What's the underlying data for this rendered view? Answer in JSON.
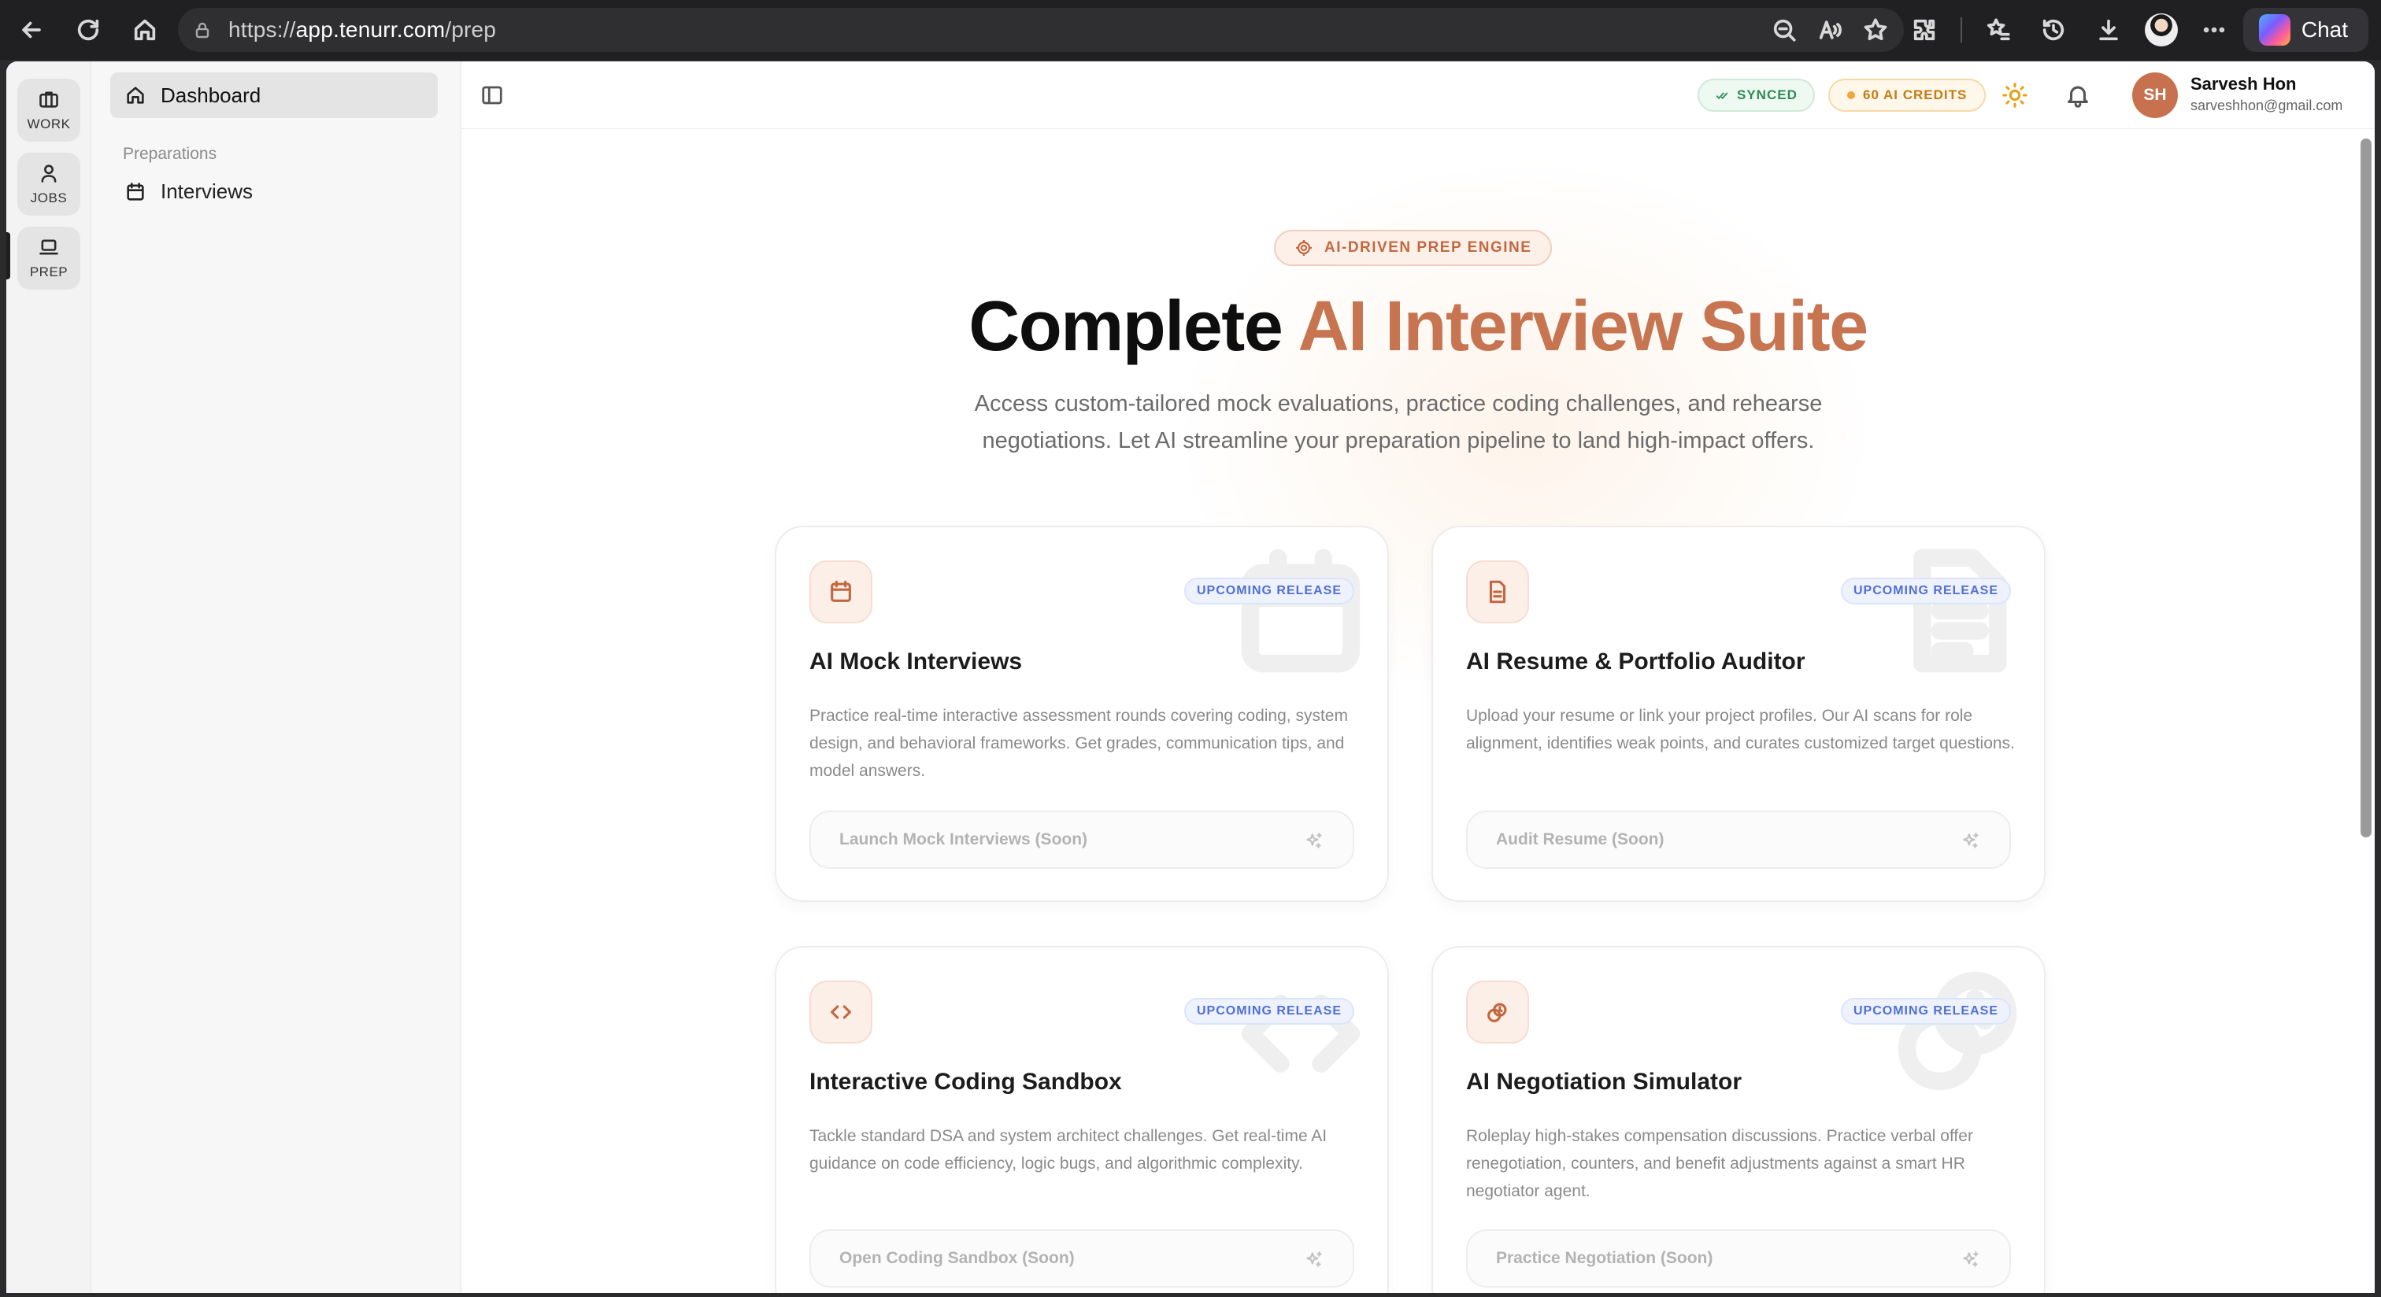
{
  "browser": {
    "url_scheme": "https://",
    "url_host": "app.tenurr.com",
    "url_path": "/prep",
    "chat_label": "Chat"
  },
  "rail": {
    "items": [
      {
        "label": "WORK",
        "icon": "briefcase-icon"
      },
      {
        "label": "JOBS",
        "icon": "user-icon"
      },
      {
        "label": "PREP",
        "icon": "laptop-icon"
      }
    ]
  },
  "sidebar": {
    "dashboard_label": "Dashboard",
    "section_label": "Preparations",
    "interviews_label": "Interviews"
  },
  "topbar": {
    "synced_label": "SYNCED",
    "credits_label": "60 AI CREDITS",
    "user_initials": "SH",
    "user_name": "Sarvesh Hon",
    "user_email": "sarveshhon@gmail.com"
  },
  "hero": {
    "badge": "AI-DRIVEN PREP ENGINE",
    "title_plain": "Complete ",
    "title_accent": "AI Interview Suite",
    "subtitle": "Access custom-tailored mock evaluations, practice coding challenges, and rehearse negotiations. Let AI streamline your preparation pipeline to land high-impact offers."
  },
  "cards": [
    {
      "badge": "UPCOMING RELEASE",
      "title": "AI Mock Interviews",
      "description": "Practice real-time interactive assessment rounds covering coding, system design, and behavioral frameworks. Get grades, communication tips, and model answers.",
      "button": "Launch Mock Interviews (Soon)",
      "icon": "calendar-icon"
    },
    {
      "badge": "UPCOMING RELEASE",
      "title": "AI Resume & Portfolio Auditor",
      "description": "Upload your resume or link your project profiles. Our AI scans for role alignment, identifies weak points, and curates customized target questions.",
      "button": "Audit Resume (Soon)",
      "icon": "document-icon"
    },
    {
      "badge": "UPCOMING RELEASE",
      "title": "Interactive Coding Sandbox",
      "description": "Tackle standard DSA and system architect challenges. Get real-time AI guidance on code efficiency, logic bugs, and algorithmic complexity.",
      "button": "Open Coding Sandbox (Soon)",
      "icon": "code-icon"
    },
    {
      "badge": "UPCOMING RELEASE",
      "title": "AI Negotiation Simulator",
      "description": "Roleplay high-stakes compensation discussions. Practice verbal offer renegotiation, counters, and benefit adjustments against a smart HR negotiator agent.",
      "button": "Practice Negotiation (Soon)",
      "icon": "handshake-icon"
    }
  ],
  "colors": {
    "accent": "#c77451",
    "synced": "#2e8a56",
    "credits": "#c57a12",
    "badge_blue": "#4f6fd8"
  }
}
